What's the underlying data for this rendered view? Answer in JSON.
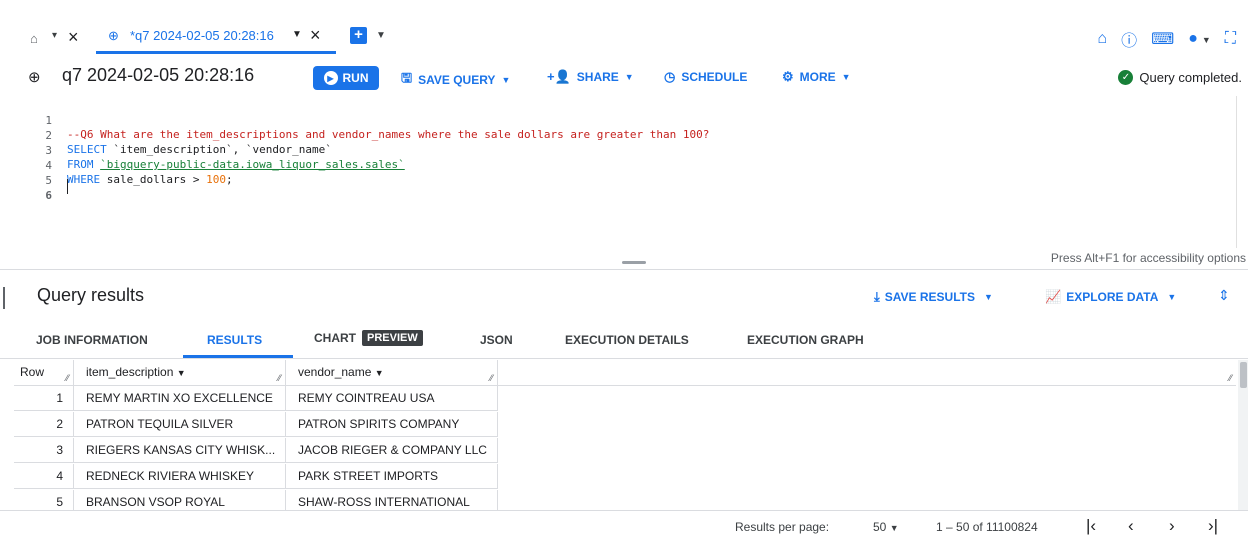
{
  "tabs": {
    "home_caret": "▾",
    "active_tab_label": "*q7 2024-02-05 20:28:16"
  },
  "query": {
    "title": "q7 2024-02-05 20:28:16",
    "status": "Query completed."
  },
  "toolbar": {
    "run": "RUN",
    "save_query": "SAVE QUERY",
    "share": "SHARE",
    "schedule": "SCHEDULE",
    "more": "MORE"
  },
  "editor": {
    "lines": [
      {
        "n": "1",
        "text": "--Q6 What are the item_descriptions and vendor_names where the sale dollars are greater than 100?"
      },
      {
        "n": "2",
        "kw": "SELECT",
        "text": " `item_description`, `vendor_name`"
      },
      {
        "n": "3",
        "kw": "FROM",
        "str": "`bigquery-public-data.iowa_liquor_sales.sales`"
      },
      {
        "n": "4",
        "kw": "WHERE",
        "text": " sale_dollars > ",
        "num": "100",
        "tail": ";"
      },
      {
        "n": "5"
      },
      {
        "n": "6"
      }
    ],
    "accessibility_hint": "Press Alt+F1 for accessibility options"
  },
  "results": {
    "title": "Query results",
    "save_results": "SAVE RESULTS",
    "explore_data": "EXPLORE DATA",
    "tabs": [
      "JOB INFORMATION",
      "RESULTS",
      "CHART",
      "JSON",
      "EXECUTION DETAILS",
      "EXECUTION GRAPH"
    ],
    "preview_badge": "PREVIEW",
    "columns": [
      "Row",
      "item_description",
      "vendor_name"
    ],
    "rows": [
      [
        "1",
        "REMY MARTIN XO EXCELLENCE",
        "REMY COINTREAU USA"
      ],
      [
        "2",
        "PATRON TEQUILA SILVER",
        "PATRON SPIRITS COMPANY"
      ],
      [
        "3",
        "RIEGERS KANSAS CITY WHISK...",
        "JACOB RIEGER & COMPANY LLC"
      ],
      [
        "4",
        "REDNECK RIVIERA WHISKEY",
        "PARK STREET IMPORTS"
      ],
      [
        "5",
        "BRANSON VSOP ROYAL",
        "SHAW-ROSS INTERNATIONAL"
      ]
    ]
  },
  "pagination": {
    "per_page_label": "Results per page:",
    "per_page_value": "50",
    "range": "1 – 50 of 11100824"
  },
  "colors": {
    "accent": "#1a73e8",
    "success": "#188038",
    "comment": "#c5221f",
    "number": "#e8710a"
  }
}
